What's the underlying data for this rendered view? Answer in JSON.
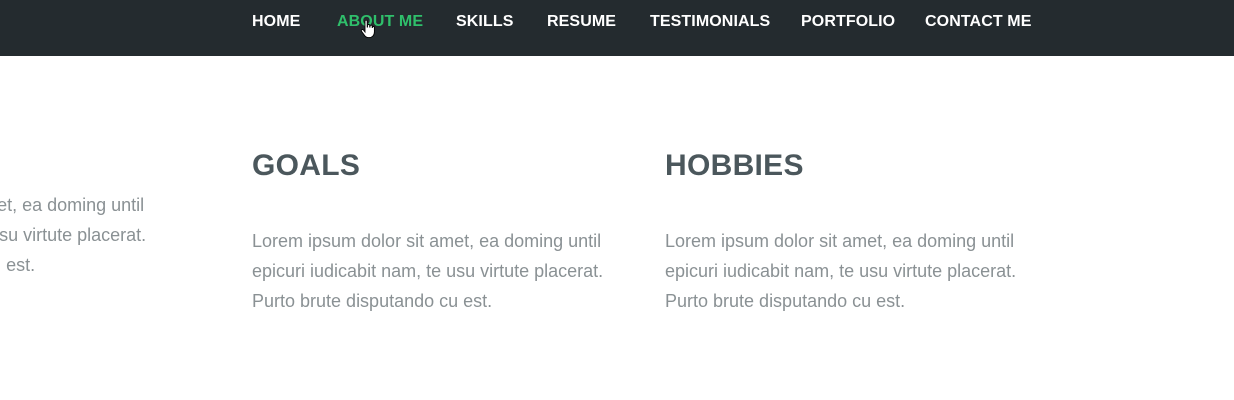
{
  "nav": {
    "items": [
      {
        "label": "HOME",
        "active": false
      },
      {
        "label": "ABOUT ME",
        "active": true
      },
      {
        "label": "SKILLS",
        "active": false
      },
      {
        "label": "RESUME",
        "active": false
      },
      {
        "label": "TESTIMONIALS",
        "active": false
      },
      {
        "label": "PORTFOLIO",
        "active": false
      },
      {
        "label": "CONTACT ME",
        "active": false
      }
    ],
    "accent_color": "#2fbf6b",
    "background_color": "#242b2f"
  },
  "columns": [
    {
      "title": "",
      "text": "Lorem ipsum dolor sit amet, ea doming until epicuri iudicabit nam, te usu virtute placerat. Purto brute disputando cu est."
    },
    {
      "title": "GOALS",
      "text": "Lorem ipsum dolor sit amet, ea doming until epicuri iudicabit nam, te usu virtute placerat. Purto brute disputando cu est."
    },
    {
      "title": "HOBBIES",
      "text": "Lorem ipsum dolor sit amet, ea doming until epicuri iudicabit nam, te usu virtute placerat. Purto brute disputando cu est."
    }
  ],
  "cursor": {
    "icon": "hand-pointer-icon"
  }
}
